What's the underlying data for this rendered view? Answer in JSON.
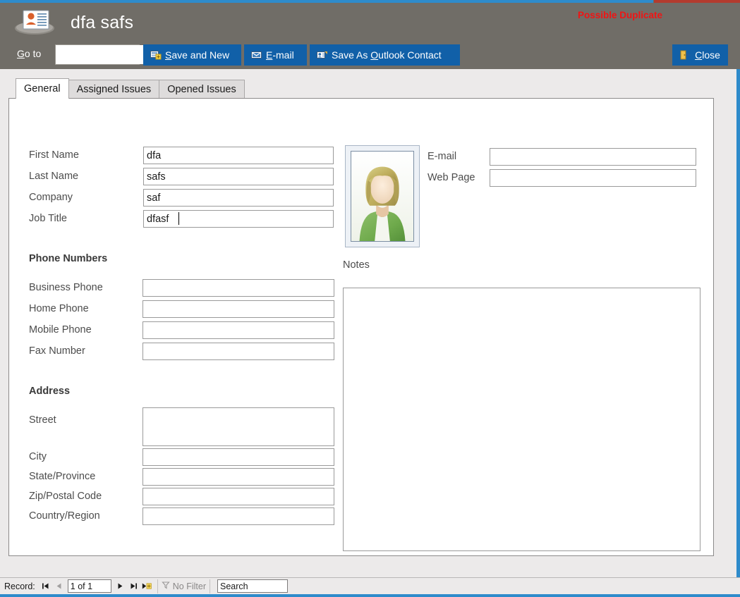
{
  "window": {
    "title": "dfa safs",
    "header_icon": "contact-card-icon",
    "duplicate_warning": "Possible Duplicate",
    "accent_blue": "#2e8bcb",
    "header_gray": "#706d67",
    "button_blue": "#1160a8",
    "warning_red": "#f01414"
  },
  "toolbar": {
    "goto_label_prefix": "G",
    "goto_label_rest": "o to",
    "goto_value": "",
    "goto_placeholder": "",
    "buttons": [
      {
        "key": "save-and-new",
        "icon": "save-new-icon",
        "prefix": "",
        "accesskey": "S",
        "rest": "ave and New"
      },
      {
        "key": "email",
        "icon": "envelope-icon",
        "prefix": "",
        "accesskey": "E",
        "rest": "-mail"
      },
      {
        "key": "save-outlook",
        "icon": "outlook-contact-icon",
        "prefix": "Save As ",
        "accesskey": "O",
        "rest": "utlook Contact"
      },
      {
        "key": "close",
        "icon": "close-door-icon",
        "prefix": "",
        "accesskey": "C",
        "rest": "lose"
      }
    ]
  },
  "tabs": [
    {
      "label": "General",
      "active": true
    },
    {
      "label": "Assigned Issues",
      "active": false
    },
    {
      "label": "Opened Issues",
      "active": false
    }
  ],
  "form": {
    "identity_fields": [
      {
        "label": "First Name",
        "value": "dfa",
        "focused": false
      },
      {
        "label": "Last Name",
        "value": "safs",
        "focused": false
      },
      {
        "label": "Company",
        "value": "saf",
        "focused": false
      },
      {
        "label": "Job Title",
        "value": "dfasf",
        "focused": true
      }
    ],
    "phone_section_title": "Phone Numbers",
    "phone_fields": [
      {
        "label": "Business Phone",
        "value": ""
      },
      {
        "label": "Home Phone",
        "value": ""
      },
      {
        "label": "Mobile Phone",
        "value": ""
      },
      {
        "label": "Fax Number",
        "value": ""
      }
    ],
    "address_section_title": "Address",
    "address_fields": [
      {
        "label": "Street",
        "value": "",
        "tall": true
      },
      {
        "label": "City",
        "value": "",
        "tall": false
      },
      {
        "label": "State/Province",
        "value": "",
        "tall": false
      },
      {
        "label": "Zip/Postal Code",
        "value": "",
        "tall": false
      },
      {
        "label": "Country/Region",
        "value": "",
        "tall": false
      }
    ],
    "photo": {
      "alt": "contact-photo-placeholder"
    },
    "contact_fields": [
      {
        "label": "E-mail",
        "value": ""
      },
      {
        "label": "Web Page",
        "value": ""
      }
    ],
    "notes_label": "Notes",
    "notes_value": ""
  },
  "statusbar": {
    "record_label": "Record:",
    "record_value": "1 of 1",
    "first_icon": "first-record-icon",
    "prev_icon": "previous-record-icon",
    "next_icon": "next-record-icon",
    "last_icon": "last-record-icon",
    "new_icon": "new-record-icon",
    "filter_icon": "filter-icon",
    "filter_label": "No Filter",
    "search_value": "Search",
    "search_placeholder": "Search"
  }
}
